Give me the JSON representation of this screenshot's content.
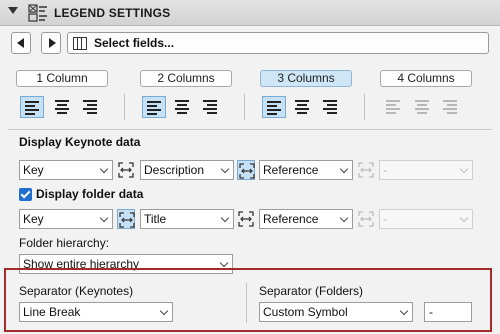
{
  "header": {
    "title": "LEGEND SETTINGS",
    "icon": "legend-settings-icon"
  },
  "field_bar": {
    "label": "Select fields..."
  },
  "columns": {
    "buttons": [
      {
        "label": "1 Column",
        "active": false
      },
      {
        "label": "2 Columns",
        "active": false
      },
      {
        "label": "3 Columns",
        "active": true
      },
      {
        "label": "4 Columns",
        "active": false
      }
    ]
  },
  "keynote": {
    "title": "Display Keynote data",
    "fields": [
      "Key",
      "Description",
      "Reference",
      "-"
    ]
  },
  "folder": {
    "checkbox_label": "Display folder data",
    "checked": true,
    "fields": [
      "Key",
      "Title",
      "Reference",
      "-"
    ],
    "hierarchy_label": "Folder hierarchy:",
    "hierarchy_value": "Show entire hierarchy"
  },
  "separators": {
    "keynotes_label": "Separator (Keynotes)",
    "keynotes_value": "Line Break",
    "folders_label": "Separator (Folders)",
    "folders_value": "Custom Symbol",
    "custom_symbol": "-"
  },
  "colors": {
    "highlight": "#a52a2a",
    "selection": "#c6e1f6",
    "active_button": "#cfe6f7",
    "checkbox": "#1f6fd1"
  }
}
